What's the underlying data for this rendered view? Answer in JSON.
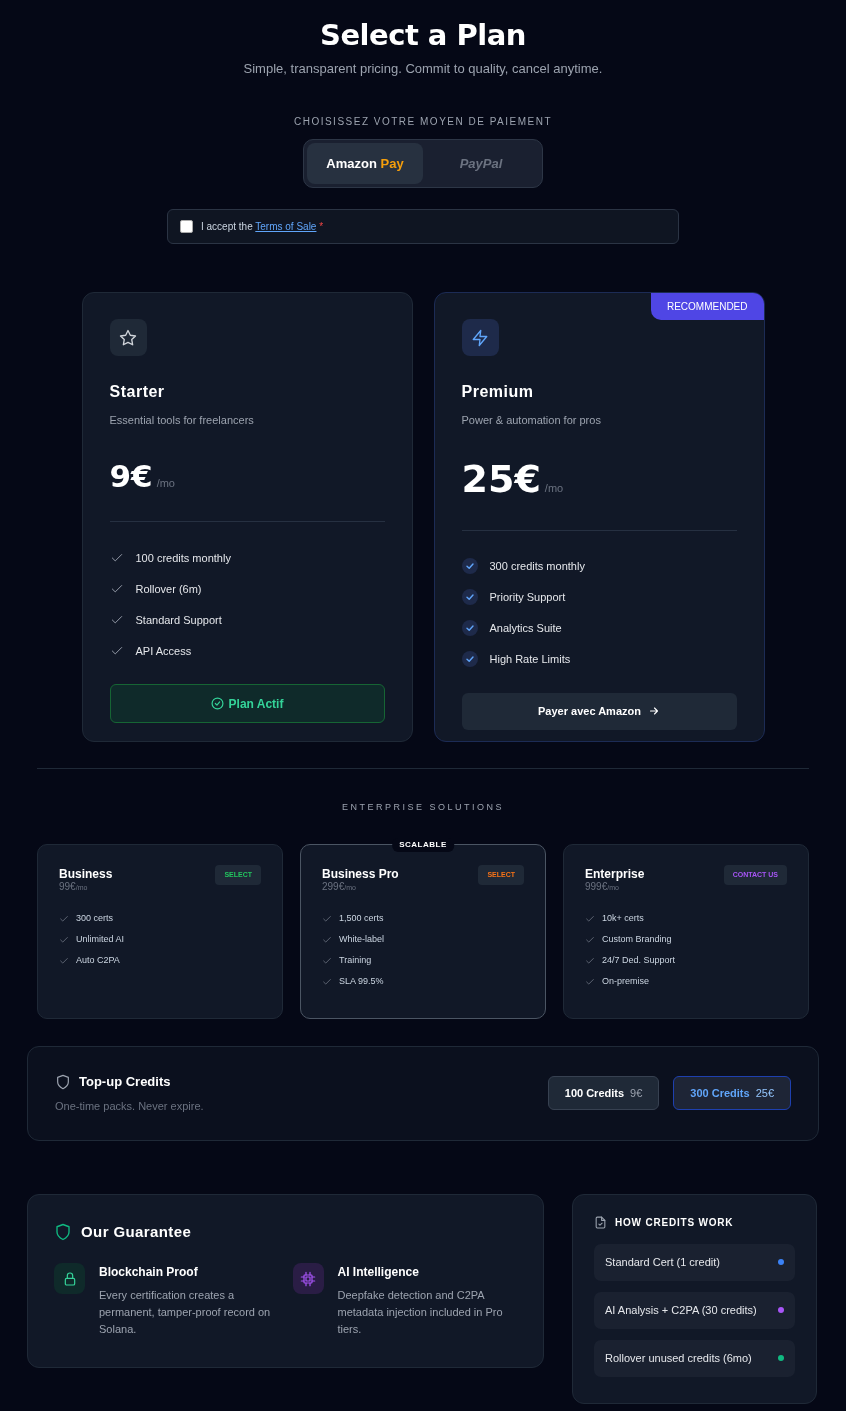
{
  "header": {
    "title": "Select a Plan",
    "subtitle": "Simple, transparent pricing. Commit to quality, cancel anytime."
  },
  "payment": {
    "label": "CHOISISSEZ VOTRE MOYEN DE PAIEMENT",
    "options": [
      {
        "kind": "amazon",
        "text": "Amazon",
        "accent": "Pay",
        "selected": true
      },
      {
        "kind": "paypal",
        "text": "PayPal",
        "selected": false
      }
    ]
  },
  "terms": {
    "checked": false,
    "text": "I accept the",
    "link": "Terms of Sale",
    "required_mark": "*"
  },
  "plans": [
    {
      "kind": "star",
      "name": "Starter",
      "description": "Essential tools for freelancers",
      "price": "9€",
      "period": "/mo",
      "highlighted": false,
      "features": [
        "100 credits monthly",
        "Rollover (6m)",
        "Standard Support",
        "API Access"
      ],
      "button": {
        "kind": "active",
        "label": "Plan Actif"
      }
    },
    {
      "kind": "bolt",
      "name": "Premium",
      "description": "Power & automation for pros",
      "price": "25€",
      "period": "/mo",
      "highlighted": true,
      "badge": "RECOMMENDED",
      "features": [
        "300 credits monthly",
        "Priority Support",
        "Analytics Suite",
        "High Rate Limits"
      ],
      "button": {
        "kind": "pay",
        "label": "Payer avec Amazon"
      }
    }
  ],
  "enterprise": {
    "heading": "ENTERPRISE SOLUTIONS",
    "tiers": [
      {
        "name": "Business",
        "price": "99€",
        "period": "/mo",
        "action": "SELECT",
        "color": "#22c55e",
        "highlighted": false,
        "features": [
          "300 certs",
          "Unlimited AI",
          "Auto C2PA"
        ]
      },
      {
        "name": "Business Pro",
        "price": "299€",
        "period": "/mo",
        "action": "SELECT",
        "color": "#f97316",
        "highlighted": true,
        "badge": "SCALABLE",
        "features": [
          "1,500 certs",
          "White-label",
          "Training",
          "SLA 99.5%"
        ]
      },
      {
        "name": "Enterprise",
        "price": "999€",
        "period": "/mo",
        "action": "CONTACT US",
        "color": "#a855f7",
        "highlighted": false,
        "features": [
          "10k+ certs",
          "Custom Branding",
          "24/7 Ded. Support",
          "On-premise"
        ]
      }
    ]
  },
  "topup": {
    "title": "Top-up Credits",
    "subtitle": "One-time packs. Never expire.",
    "packs": [
      {
        "label": "100 Credits",
        "price": "9€",
        "selected": false
      },
      {
        "label": "300 Credits",
        "price": "25€",
        "selected": true
      }
    ]
  },
  "guarantee": {
    "title": "Our Guarantee",
    "items": [
      {
        "kind": "lock",
        "title": "Blockchain Proof",
        "text": "Every certification creates a permanent, tamper-proof record on Solana."
      },
      {
        "kind": "chip",
        "title": "AI Intelligence",
        "text": "Deepfake detection and C2PA metadata injection included in Pro tiers."
      }
    ]
  },
  "credits_info": {
    "title": "HOW CREDITS WORK",
    "items": [
      {
        "label": "Standard Cert (1 credit)",
        "color": "#3b82f6"
      },
      {
        "label": "AI Analysis + C2PA (30 credits)",
        "color": "#a855f7"
      },
      {
        "label": "Rollover unused credits (6mo)",
        "color": "#10b981"
      }
    ]
  }
}
